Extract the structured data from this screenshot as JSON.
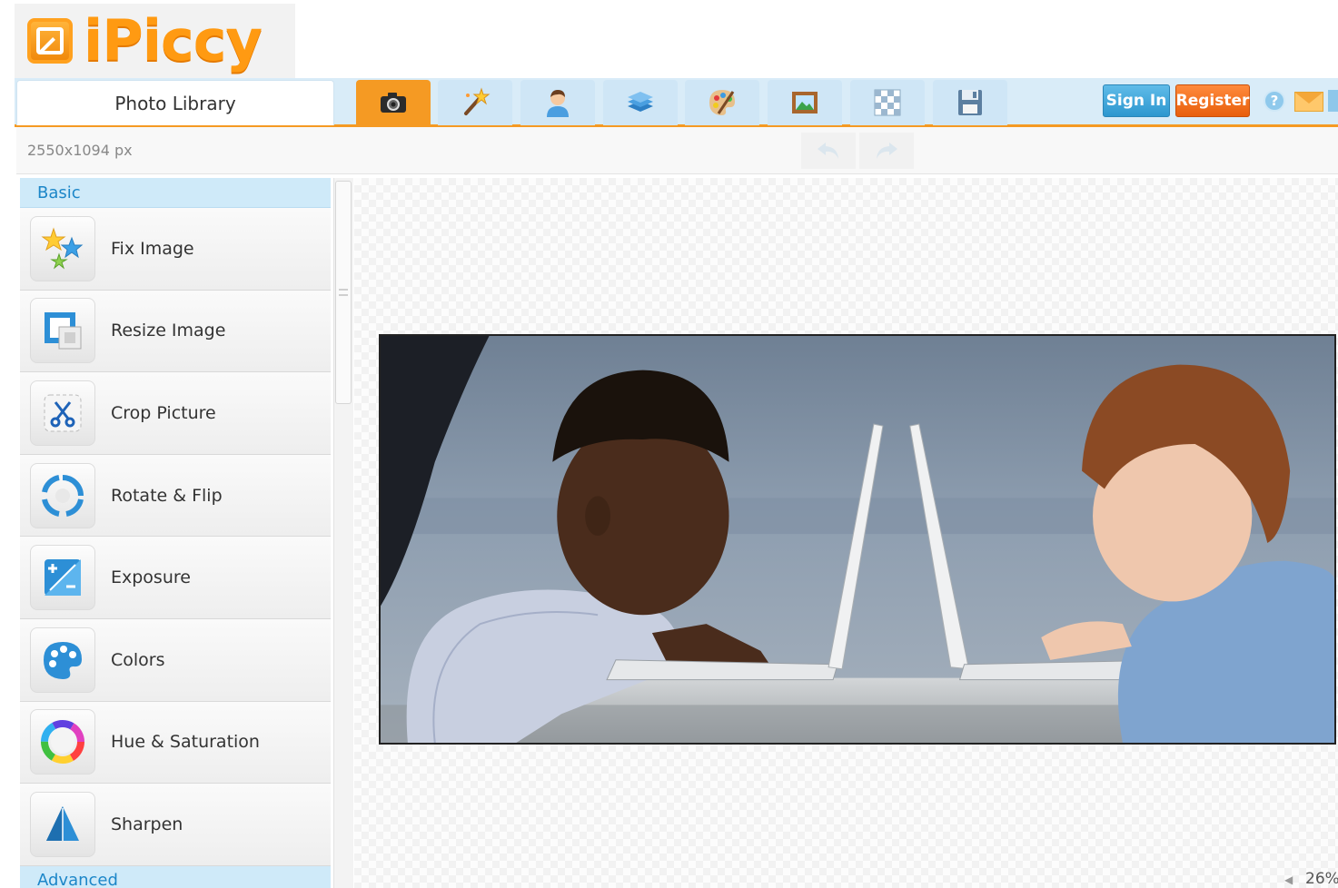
{
  "app": {
    "logo_text": "iPiccy"
  },
  "topbar": {
    "photo_library": "Photo Library",
    "sign_in": "Sign In",
    "register": "Register",
    "help": "?"
  },
  "infobar": {
    "dimensions": "2550x1094 px"
  },
  "sidebar": {
    "basic_header": "Basic",
    "advanced_header": "Advanced",
    "tools": [
      {
        "label": "Fix Image"
      },
      {
        "label": "Resize Image"
      },
      {
        "label": "Crop Picture"
      },
      {
        "label": "Rotate & Flip"
      },
      {
        "label": "Exposure"
      },
      {
        "label": "Colors"
      },
      {
        "label": "Hue & Saturation"
      },
      {
        "label": "Sharpen"
      }
    ]
  },
  "canvas": {
    "zoom": "26%"
  },
  "colors": {
    "accent_orange": "#f59a23",
    "accent_blue": "#1c86c8",
    "topbar_bg": "#d9ecf8"
  }
}
